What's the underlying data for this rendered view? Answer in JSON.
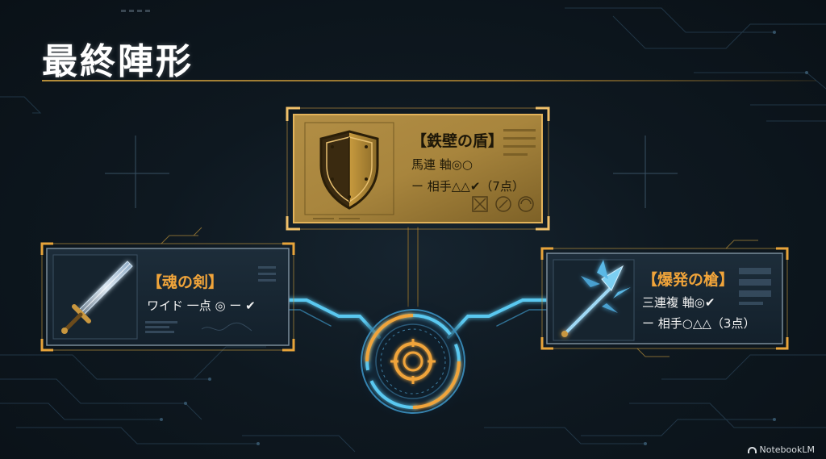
{
  "slide": {
    "title": "最終陣形"
  },
  "cards": {
    "shield": {
      "name": "【鉄壁の盾】",
      "line1": "馬連 軸◎○",
      "line2": "ー 相手△△✔（7点）",
      "icon": "shield-icon"
    },
    "sword": {
      "name": "【魂の剣】",
      "line1": "ワイド 一点 ◎ ー ✔",
      "icon": "sword-icon"
    },
    "trident": {
      "name": "【爆発の槍】",
      "line1": "三連複 軸◎✔",
      "line2": "ー 相手○△△（3点）",
      "icon": "trident-icon"
    }
  },
  "hub": {
    "icon": "target-icon"
  },
  "colors": {
    "gold": "#e8a43a",
    "cyan": "#5ac8f0",
    "background": "#0d151c"
  },
  "watermark": {
    "label": "NotebookLM"
  }
}
